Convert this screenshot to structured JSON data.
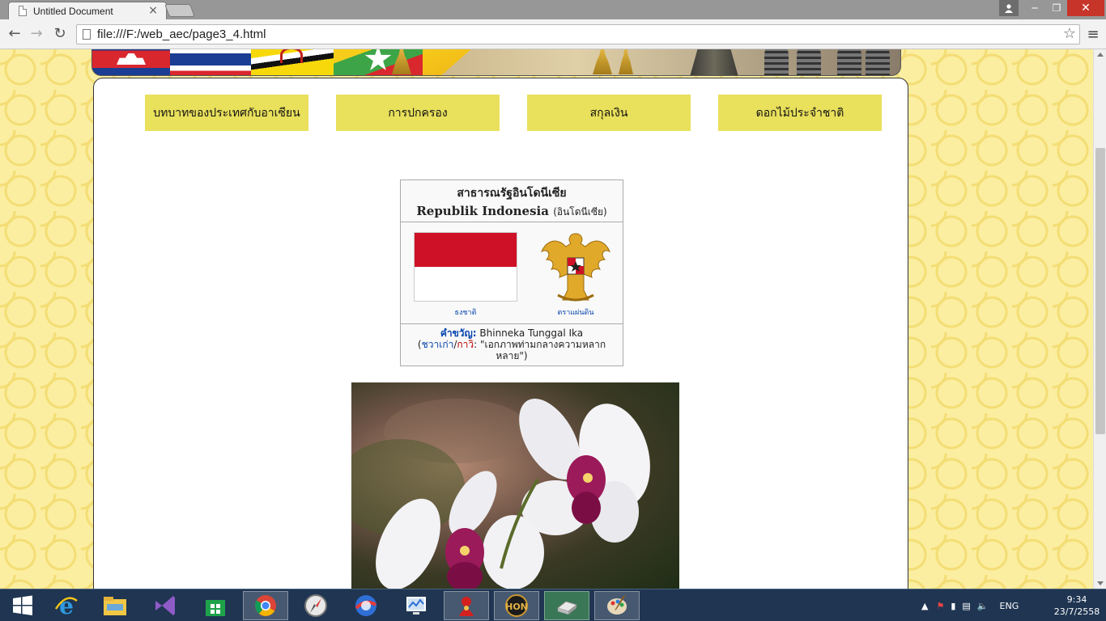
{
  "browser": {
    "tab_title": "Untitled Document",
    "tab_close": "×",
    "url": "file:///F:/web_aec/page3_4.html",
    "window_controls": {
      "minimize": "─",
      "maximize": "❐",
      "close": "✕"
    }
  },
  "page": {
    "menu": [
      {
        "label": "บทบาทของประเทศกับอาเซียน"
      },
      {
        "label": "การปกครอง"
      },
      {
        "label": "สกุลเงิน"
      },
      {
        "label": "ดอกไม้ประจำชาติ"
      }
    ],
    "infobox": {
      "thai_name": "สาธารณรัฐอินโดนีเซีย",
      "native_name": "Republik Indonesia",
      "native_lang": "(อินโดนีเซีย)",
      "flag_caption": "ธงชาติ",
      "emblem_caption": "ตราแผ่นดิน",
      "motto_label": "คำขวัญ:",
      "motto_value": "Bhinneka Tunggal Ika",
      "motto_lang_open": "(",
      "motto_lang1": "ชวาเก่า",
      "motto_sep": "/",
      "motto_lang2": "กาวิ",
      "motto_translation": ": \"เอกภาพท่ามกลางความหลากหลาย\")"
    }
  },
  "taskbar": {
    "apps": [
      "start-icon",
      "internet-explorer-icon",
      "file-explorer-icon",
      "visual-studio-icon",
      "store-icon",
      "chrome-icon",
      "compass-app-icon",
      "browser-app-icon",
      "monitor-app-icon",
      "red-app-icon",
      "hon-game-icon",
      "drive-app-icon",
      "paint-app-icon"
    ],
    "language": "ENG",
    "time": "9:34",
    "date": "23/7/2558"
  },
  "colors": {
    "menu_button": "#e9e05c",
    "page_background": "#fbeea0",
    "indonesia_red": "#ce1126",
    "link_blue": "#0645ad",
    "taskbar": "#1f3552"
  }
}
